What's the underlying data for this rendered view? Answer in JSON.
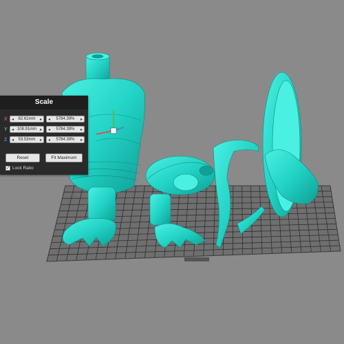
{
  "colors": {
    "background": "#8a8a8a",
    "model": "#22d3c5",
    "model_shadow": "#0f9f95",
    "build_plate_grid": "#2e2e2e",
    "axis_x": "#d9534f",
    "axis_y": "#5cb85c",
    "axis_z": "#428bca"
  },
  "scale_panel": {
    "title": "Scale",
    "rows": [
      {
        "axis": "X",
        "mm": "82.61mm",
        "percent": "5784.39%"
      },
      {
        "axis": "Y",
        "mm": "108.91mm",
        "percent": "5784.39%"
      },
      {
        "axis": "Z",
        "mm": "53.53mm",
        "percent": "5784.39%"
      }
    ],
    "reset_label": "Reset",
    "fit_label": "Fit Maximum",
    "lock_ratio_label": "Lock Ratio",
    "lock_ratio_checked": true
  },
  "icons": {
    "stepper_left": "triangle-left-icon",
    "stepper_right": "triangle-right-icon",
    "checkbox": "checkmark-icon"
  }
}
